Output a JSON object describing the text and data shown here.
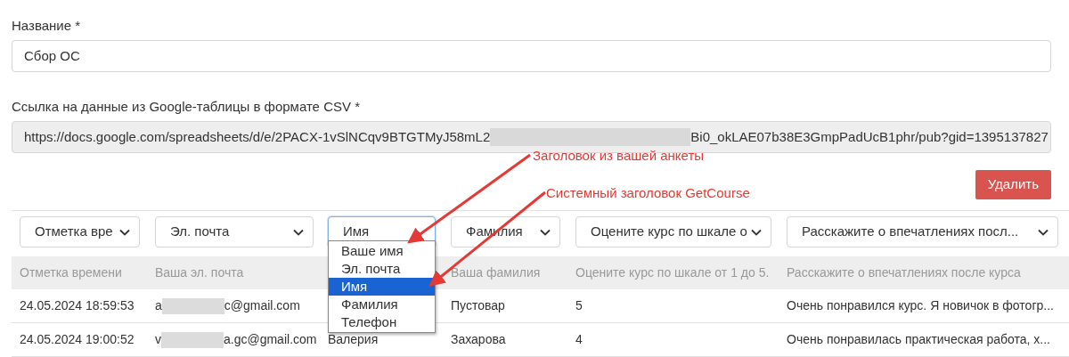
{
  "fields": [
    {
      "label": "Название *",
      "value": "Сбор ОС",
      "disabled": false
    },
    {
      "label": "Ссылка на данные из Google-таблицы в формате CSV *",
      "value_start": "https://docs.google.com/spreadsheets/d/e/2PACX-1vSlNCqv9BTGTMyJ58mL2",
      "value_end": "Bi0_okLAE07b38E3GmpPadUcB1phr/pub?gid=1395137827",
      "disabled": true
    }
  ],
  "annotations": [
    "Заголовок из вашей анкеты",
    "Системный заголовок GetCourse"
  ],
  "delete_button": "Удалить",
  "column_selects": [
    {
      "value": "Отметка вре",
      "open": false
    },
    {
      "value": "Эл. почта",
      "open": false
    },
    {
      "value": "Имя",
      "open": true
    },
    {
      "value": "Фамилия",
      "open": false
    },
    {
      "value": "Оцените курс по шкале о",
      "open": false
    },
    {
      "value": "Расскажите о впечатлениях посл...",
      "open": false
    }
  ],
  "dropdown_options": [
    {
      "label": "Ваше имя",
      "selected": false
    },
    {
      "label": "Эл. почта",
      "selected": false
    },
    {
      "label": "Имя",
      "selected": true
    },
    {
      "label": "Фамилия",
      "selected": false
    },
    {
      "label": "Телефон",
      "selected": false
    }
  ],
  "table": {
    "columns": [
      "Отметка времени",
      "Ваша эл. почта",
      "",
      "Ваша фамилия",
      "Оцените курс по шкале от 1 до 5.",
      "Расскажите о впечатлениях после курса"
    ],
    "rows": [
      [
        "24.05.2024 18:59:53",
        {
          "start": "a",
          "end": "c@gmail.com"
        },
        "",
        "Пустовар",
        "5",
        "Очень понравился курс. Я новичок в фотогр..."
      ],
      [
        "24.05.2024 19:00:52",
        {
          "start": "v",
          "end": "a.gc@gmail.com"
        },
        "Валерия",
        "Захарова",
        "4",
        "Очень понравилась практическая работа, х..."
      ]
    ]
  }
}
